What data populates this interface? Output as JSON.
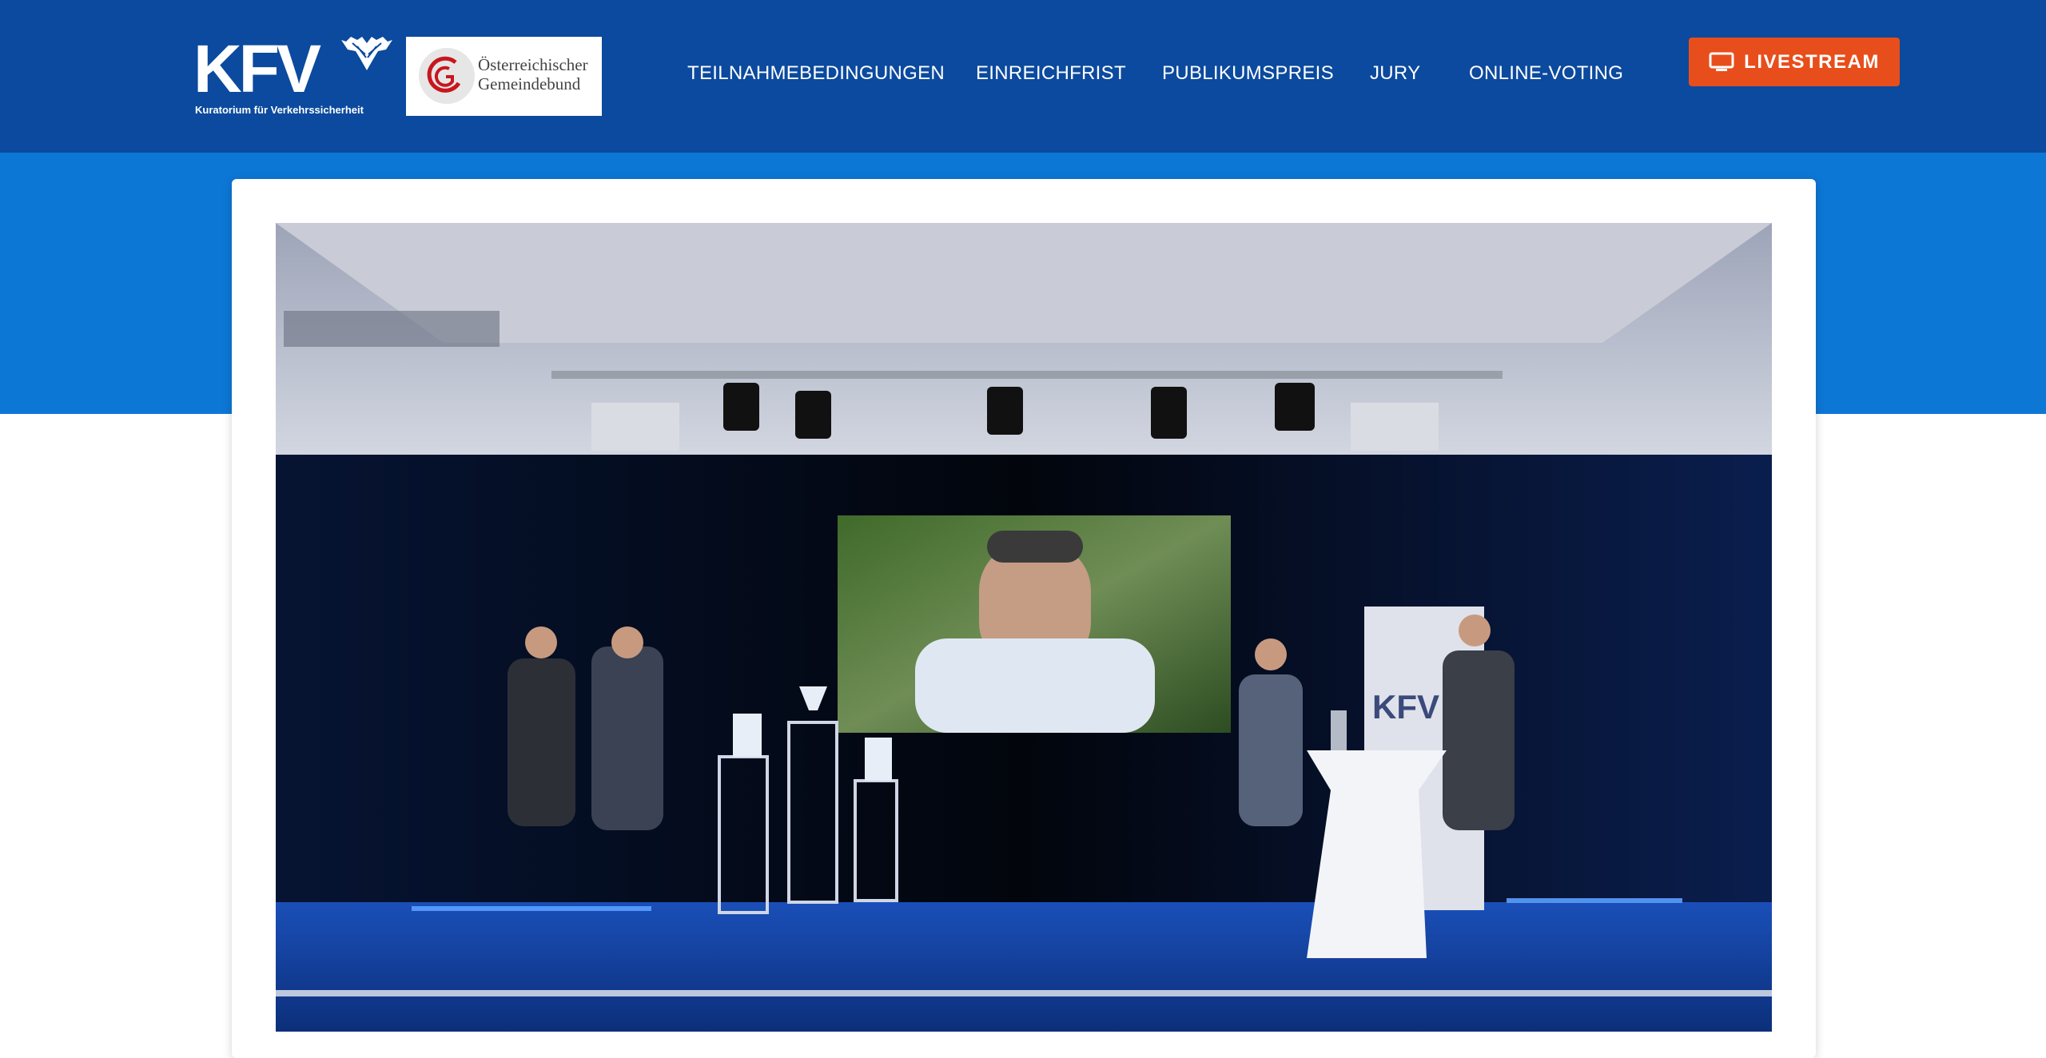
{
  "brand": {
    "kfv_wordmark": "KFV",
    "kfv_tagline": "Kuratorium für Verkehrssicherheit",
    "partner_line1": "Österreichischer",
    "partner_line2": "Gemeindebund"
  },
  "nav": {
    "items": [
      {
        "label": "TEILNAHMEBEDINGUNGEN"
      },
      {
        "label": "EINREICHFRIST"
      },
      {
        "label": "PUBLIKUMSPREIS"
      },
      {
        "label": "JURY"
      },
      {
        "label": "ONLINE-VOTING"
      }
    ],
    "cta": {
      "label": "LIVESTREAM",
      "icon": "monitor-icon"
    }
  },
  "hero": {
    "banner_text": "KFV"
  },
  "colors": {
    "header_bg": "#0b4a9e",
    "band_bg": "#0d77d6",
    "cta_bg": "#e84e1b",
    "accent_red": "#c8161d"
  }
}
